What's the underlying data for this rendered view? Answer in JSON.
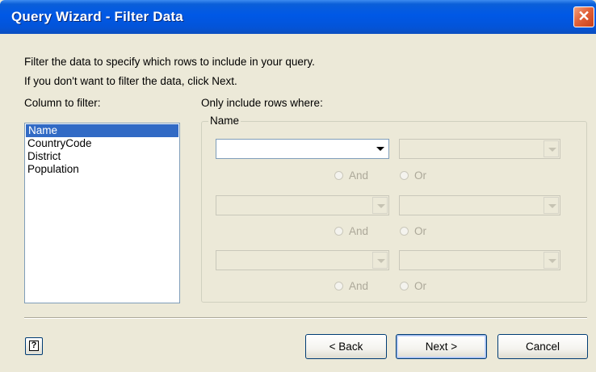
{
  "window": {
    "title": "Query Wizard - Filter Data",
    "close_glyph": "✕"
  },
  "instructions": {
    "line1": "Filter the data to specify which rows to include in your query.",
    "line2": "If you don't want to filter the data, click Next."
  },
  "columns": {
    "label": "Column to filter:",
    "items": [
      "Name",
      "CountryCode",
      "District",
      "Population"
    ],
    "selected": "Name"
  },
  "criteria": {
    "label": "Only include rows where:",
    "group_label": "Name",
    "rows": [
      {
        "operator": "",
        "value": "",
        "enabled": true
      },
      {
        "operator": "",
        "value": "",
        "enabled": false
      },
      {
        "operator": "",
        "value": "",
        "enabled": false
      }
    ],
    "and_label": "And",
    "or_label": "Or"
  },
  "buttons": {
    "help_glyph": "?",
    "back": "< Back",
    "next": "Next >",
    "cancel": "Cancel"
  },
  "icons": {
    "help": "help-icon",
    "close": "close-icon",
    "dropdown": "dropdown-arrow-icon",
    "radio": "radio-icon"
  },
  "colors": {
    "titlebar": "#0058e6",
    "selection": "#316ac5",
    "close_button": "#e2623a",
    "dialog_bg": "#ece9d8"
  }
}
